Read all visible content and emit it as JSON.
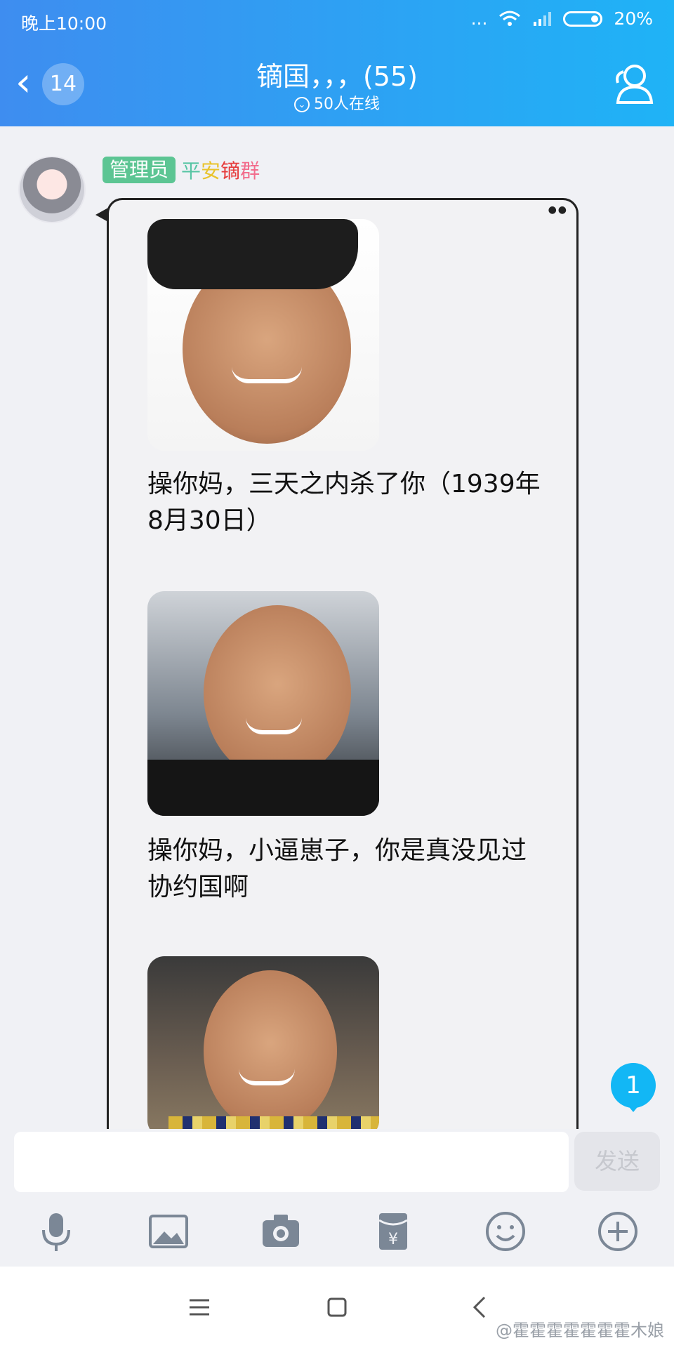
{
  "status_bar": {
    "time": "晚上10:00",
    "dots": "...",
    "battery": "20%"
  },
  "header": {
    "back_count": "14",
    "title": "镝国，，，(55)",
    "online": "50人在线"
  },
  "message": {
    "role_badge": "管理员",
    "name_parts": [
      "平",
      "安",
      "镝",
      "群"
    ],
    "captions": [
      "操你妈，三天之内杀了你（1939年8月30日）",
      "操你妈，小逼崽子，你是真没见过协约国啊"
    ]
  },
  "unread_count": "1",
  "input": {
    "placeholder": "",
    "send_label": "发送"
  },
  "toolbar_icons": [
    "mic-icon",
    "image-icon",
    "camera-icon",
    "red-packet-icon",
    "emoji-icon",
    "plus-icon"
  ],
  "watermark": "@霍霍霍霍霍霍霍木娘",
  "colors": {
    "header_start": "#3e8df0",
    "header_end": "#1fb3f6",
    "admin_badge": "#5cc593",
    "unread_badge": "#12b7f5"
  }
}
